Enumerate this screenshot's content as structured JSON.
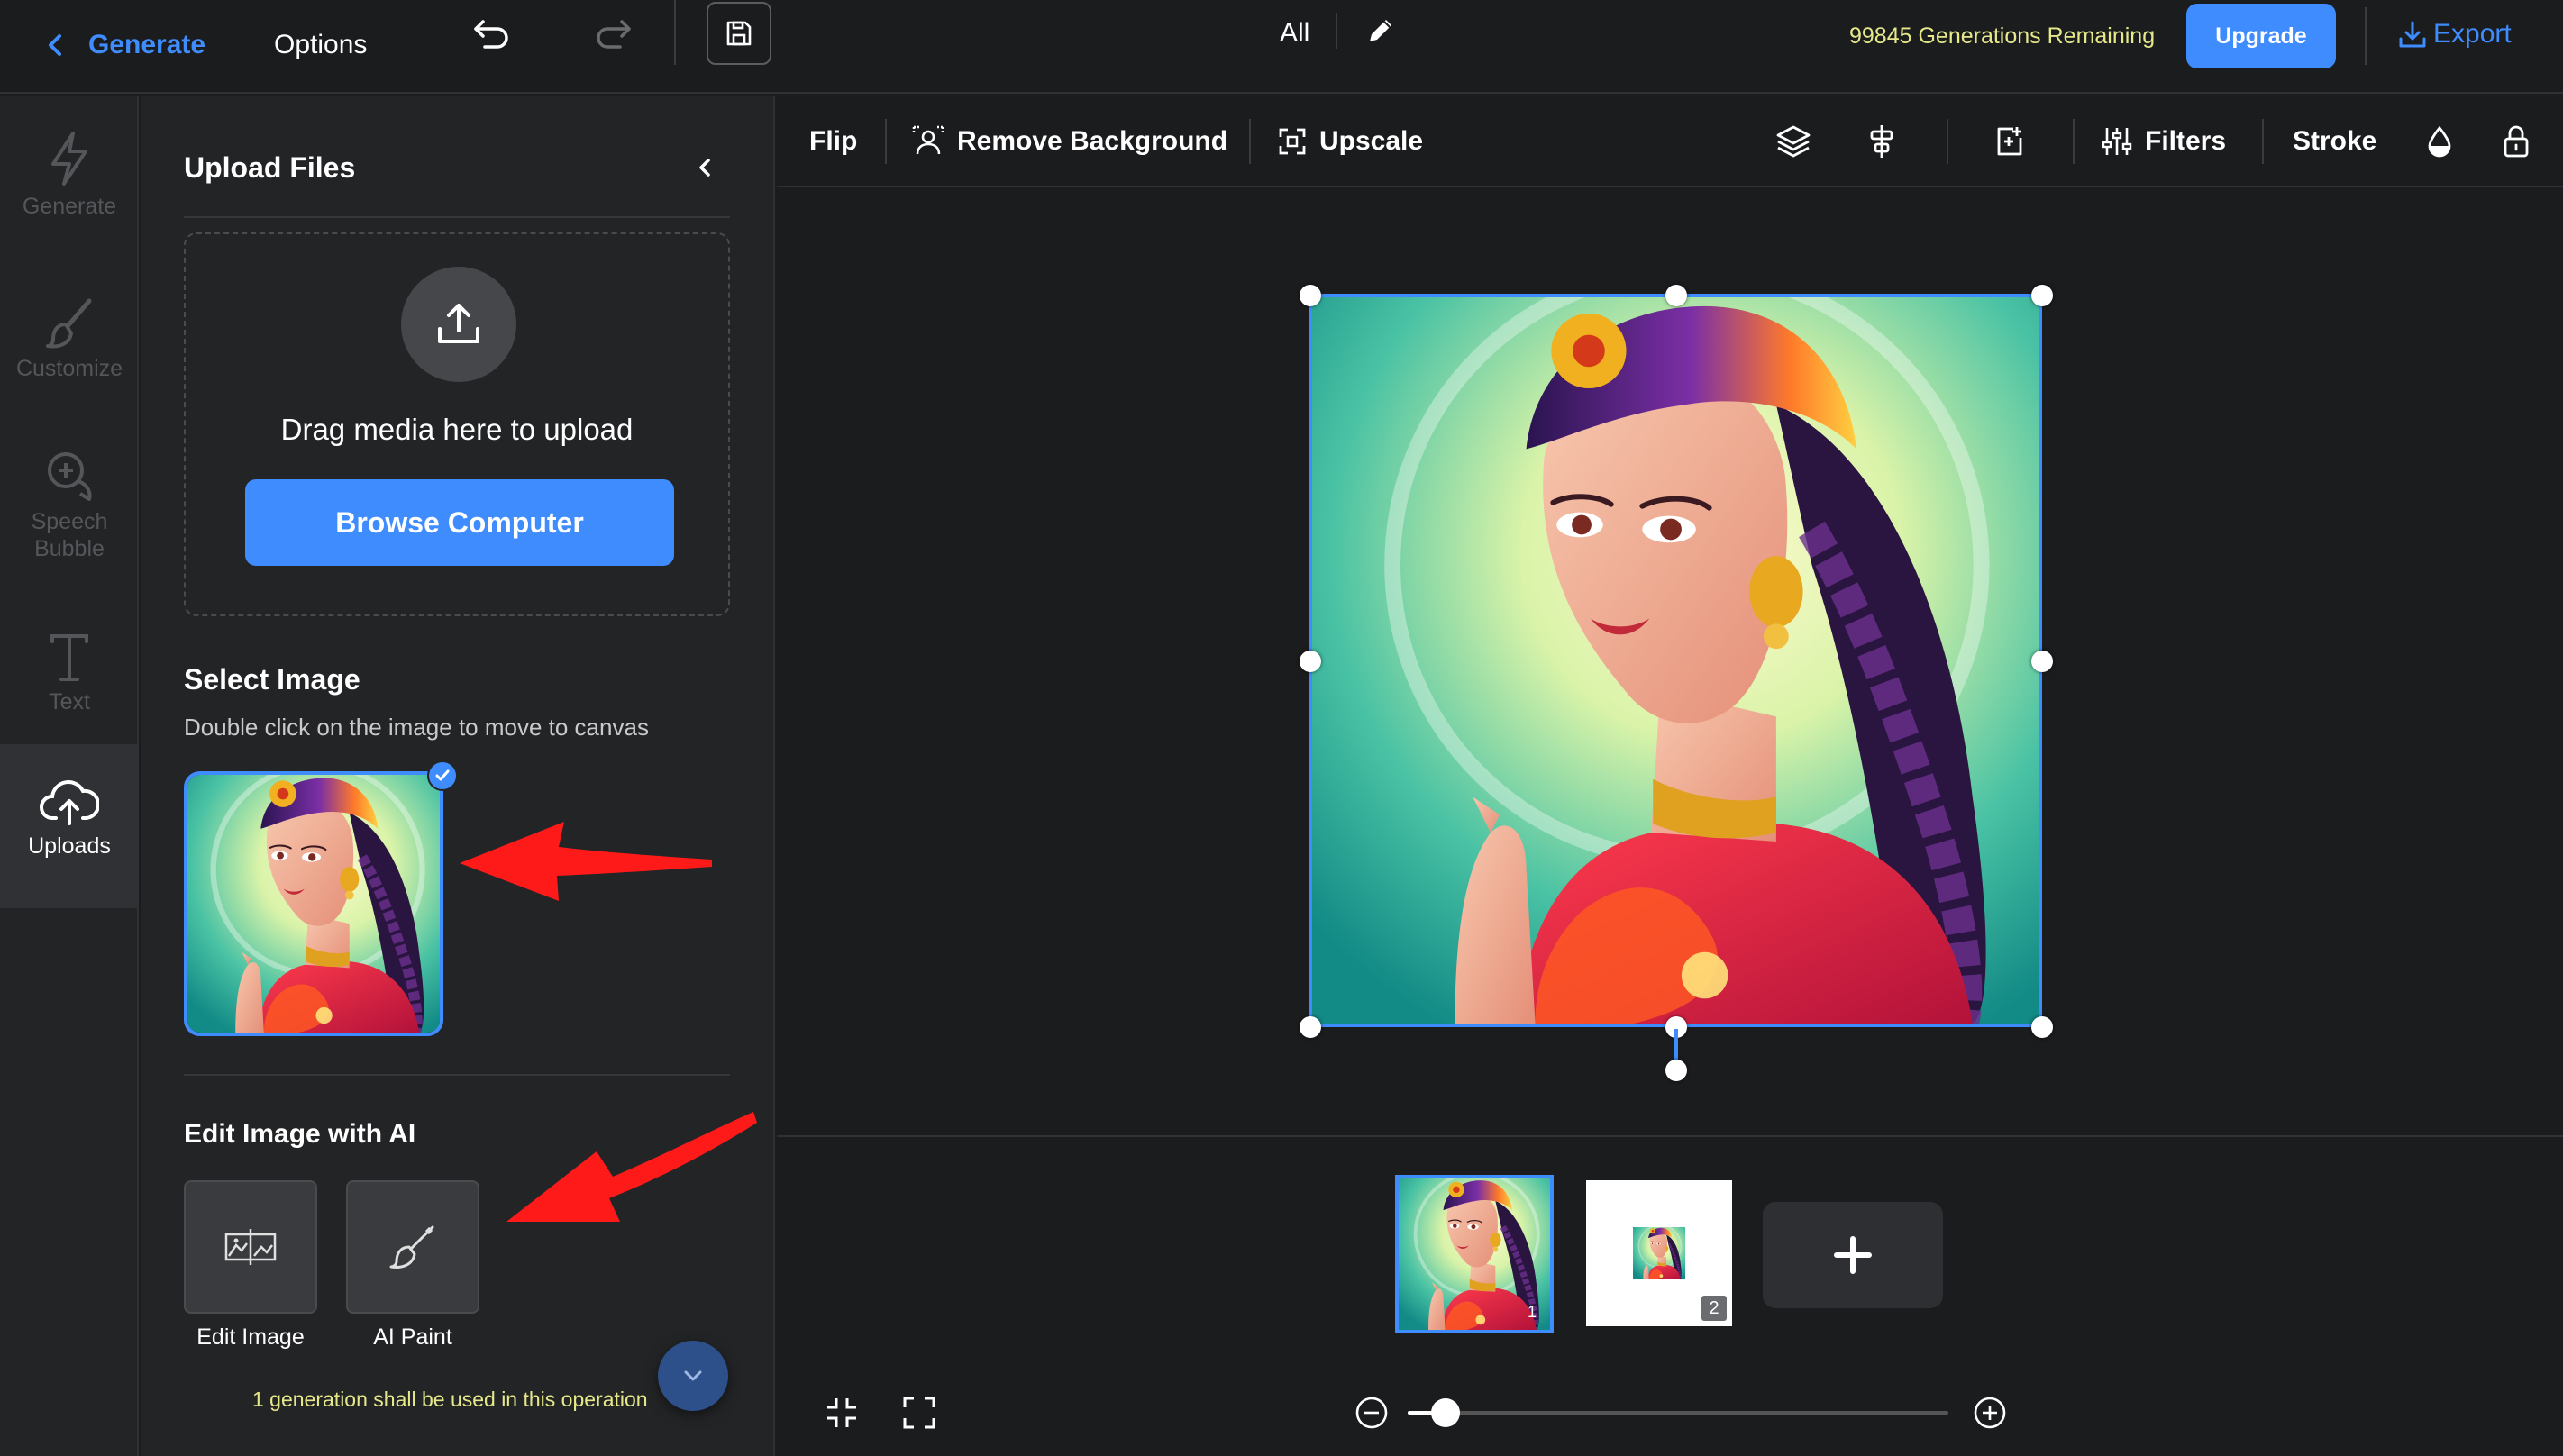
{
  "topbar": {
    "back_label": "Generate",
    "options_label": "Options",
    "view_label": "All",
    "remaining": "99845 Generations Remaining",
    "upgrade_label": "Upgrade",
    "export_label": "Export"
  },
  "nav": {
    "items": [
      {
        "label": "Generate",
        "icon": "lightning-icon"
      },
      {
        "label": "Customize",
        "icon": "brush-icon"
      },
      {
        "label": "Speech Bubble",
        "icon": "speech-bubble-icon"
      },
      {
        "label": "Text",
        "icon": "text-icon"
      },
      {
        "label": "Uploads",
        "icon": "cloud-upload-icon",
        "active": true
      }
    ]
  },
  "panel": {
    "title": "Upload Files",
    "drag_text": "Drag media here to upload",
    "browse_label": "Browse Computer",
    "select_title": "Select Image",
    "select_sub": "Double click on the image to move to canvas",
    "ai_title": "Edit Image with AI",
    "tools": [
      {
        "label": "Edit Image",
        "icon": "edit-image-icon"
      },
      {
        "label": "AI Paint",
        "icon": "paint-brush-icon"
      }
    ],
    "note": "1 generation shall be used in this operation"
  },
  "toolbar": {
    "flip": "Flip",
    "remove_bg": "Remove Background",
    "upscale": "Upscale",
    "filters": "Filters",
    "stroke": "Stroke"
  },
  "pages": {
    "items": [
      {
        "num": "1",
        "selected": true
      },
      {
        "num": "2",
        "selected": false
      }
    ]
  },
  "zoom": {
    "level": 0.07
  },
  "colors": {
    "accent": "#3f8cff",
    "highlight": "#e6e88a",
    "annotation": "#ff1a1a"
  }
}
